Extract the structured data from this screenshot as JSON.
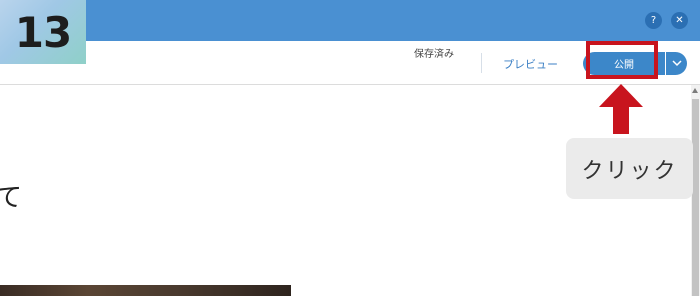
{
  "step": {
    "number": "13"
  },
  "titlebar": {
    "help_glyph": "?",
    "close_glyph": "✕",
    "color": "#4a90d2"
  },
  "toolbar": {
    "saved_status": "保存済み",
    "preview_label": "プレビュー",
    "publish_label": "公開",
    "accent_color": "#3c87c9"
  },
  "content": {
    "visible_text": "て"
  },
  "annotation": {
    "callout_text": "クリック",
    "highlight_color": "#c8141e"
  },
  "icons": [
    "help-icon",
    "close-icon",
    "chevron-down-icon",
    "arrow-up-icon"
  ]
}
